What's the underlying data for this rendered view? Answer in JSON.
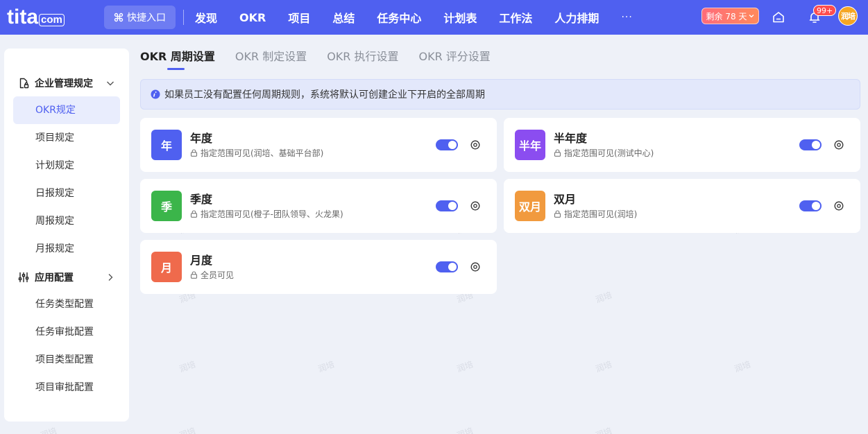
{
  "topbar": {
    "logo_main": "tita",
    "logo_suffix": "com",
    "quick_entry": "快捷入口",
    "nav": [
      "发现",
      "OKR",
      "项目",
      "总结",
      "任务中心",
      "计划表",
      "工作法",
      "人力排期"
    ],
    "more": "···",
    "trial_label": "剩余 78 天",
    "notification_badge": "99+",
    "avatar_text": "润培"
  },
  "sidebar": {
    "groups": [
      {
        "title": "企业管理规定",
        "items": [
          "OKR规定",
          "项目规定",
          "计划规定",
          "日报规定",
          "周报规定",
          "月报规定"
        ]
      },
      {
        "title": "应用配置",
        "items": [
          "任务类型配置",
          "任务审批配置",
          "项目类型配置",
          "项目审批配置"
        ]
      }
    ],
    "active_item": "OKR规定"
  },
  "tabs": [
    "OKR 周期设置",
    "OKR 制定设置",
    "OKR 执行设置",
    "OKR 评分设置"
  ],
  "notice": "如果员工没有配置任何周期规则，系统将默认可创建企业下开启的全部周期",
  "watermark": "润培",
  "periods": [
    {
      "tag": "年",
      "name": "年度",
      "scope": "指定范围可见(润培、基础平台部)",
      "color": "#4f60f0",
      "enabled": true
    },
    {
      "tag": "半年",
      "name": "半年度",
      "scope": "指定范围可见(测试中心)",
      "color": "#8b4df0",
      "enabled": true
    },
    {
      "tag": "季",
      "name": "季度",
      "scope": "指定范围可见(橙子-团队领导、火龙果)",
      "color": "#3bb54a",
      "enabled": true
    },
    {
      "tag": "双月",
      "name": "双月",
      "scope": "指定范围可见(润培)",
      "color": "#f19a3e",
      "enabled": true
    },
    {
      "tag": "月",
      "name": "月度",
      "scope": "全员可见",
      "color": "#ef6a4c",
      "enabled": true
    }
  ]
}
